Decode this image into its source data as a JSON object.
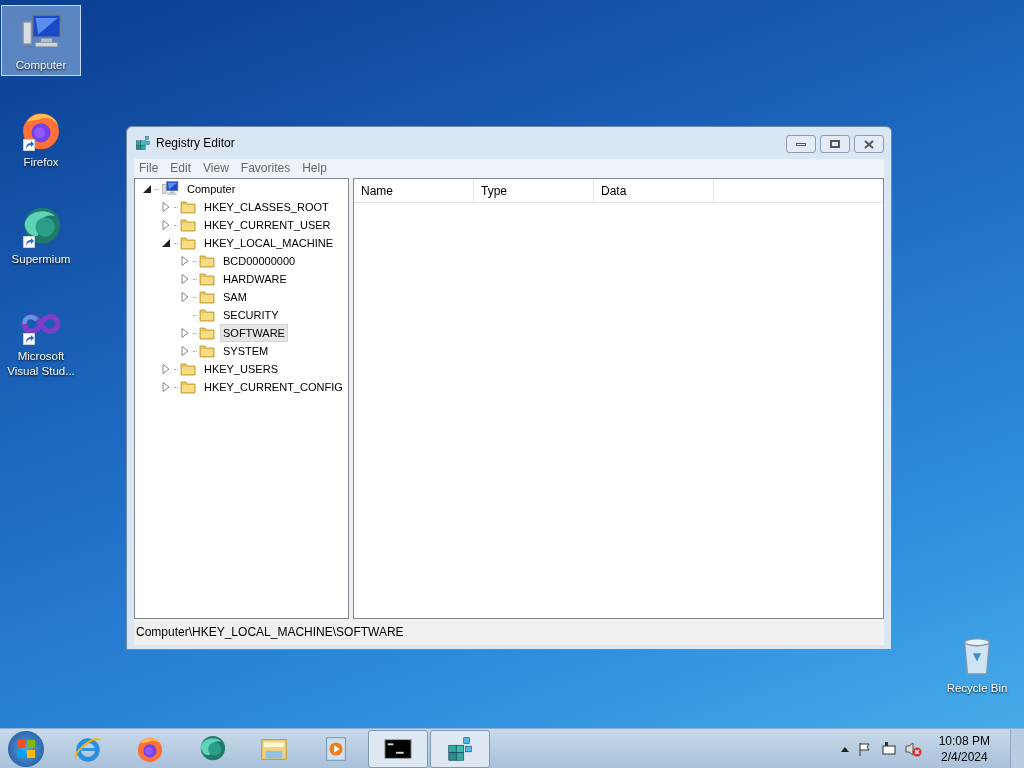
{
  "desktop_icons": [
    {
      "label": "Computer",
      "kind": "computer",
      "shortcut": false,
      "selected": true
    },
    {
      "label": "Firefox",
      "kind": "firefox",
      "shortcut": true,
      "selected": false
    },
    {
      "label": "Supermium",
      "kind": "supermium",
      "shortcut": true,
      "selected": false
    },
    {
      "label": "Microsoft Visual Stud...",
      "kind": "vs",
      "shortcut": true,
      "selected": false
    },
    {
      "label": "Recycle Bin",
      "kind": "recycle",
      "shortcut": false,
      "selected": false
    }
  ],
  "window": {
    "title": "Registry Editor",
    "menu": [
      "File",
      "Edit",
      "View",
      "Favorites",
      "Help"
    ],
    "tree": [
      {
        "label": "Computer",
        "kind": "computer",
        "expandable": true,
        "expanded": true,
        "selected": false,
        "children": [
          {
            "label": "HKEY_CLASSES_ROOT",
            "kind": "folder",
            "expandable": true,
            "expanded": false,
            "selected": false
          },
          {
            "label": "HKEY_CURRENT_USER",
            "kind": "folder",
            "expandable": true,
            "expanded": false,
            "selected": false
          },
          {
            "label": "HKEY_LOCAL_MACHINE",
            "kind": "folder",
            "expandable": true,
            "expanded": true,
            "selected": false,
            "children": [
              {
                "label": "BCD00000000",
                "kind": "folder",
                "expandable": true,
                "expanded": false,
                "selected": false
              },
              {
                "label": "HARDWARE",
                "kind": "folder",
                "expandable": true,
                "expanded": false,
                "selected": false
              },
              {
                "label": "SAM",
                "kind": "folder",
                "expandable": true,
                "expanded": false,
                "selected": false
              },
              {
                "label": "SECURITY",
                "kind": "folder",
                "expandable": false,
                "expanded": false,
                "selected": false
              },
              {
                "label": "SOFTWARE",
                "kind": "folder",
                "expandable": true,
                "expanded": false,
                "selected": true
              },
              {
                "label": "SYSTEM",
                "kind": "folder",
                "expandable": true,
                "expanded": false,
                "selected": false
              }
            ]
          },
          {
            "label": "HKEY_USERS",
            "kind": "folder",
            "expandable": true,
            "expanded": false,
            "selected": false
          },
          {
            "label": "HKEY_CURRENT_CONFIG",
            "kind": "folder",
            "expandable": true,
            "expanded": false,
            "selected": false
          }
        ]
      }
    ],
    "columns": [
      "Name",
      "Type",
      "Data"
    ],
    "status_bar": "Computer\\HKEY_LOCAL_MACHINE\\SOFTWARE"
  },
  "taskbar": {
    "buttons": [
      {
        "kind": "ie",
        "open": false
      },
      {
        "kind": "firefox",
        "open": false
      },
      {
        "kind": "supermium",
        "open": false
      },
      {
        "kind": "explorer",
        "open": false
      },
      {
        "kind": "media",
        "open": false
      },
      {
        "kind": "cmd",
        "open": true
      },
      {
        "kind": "regedit",
        "open": true
      }
    ],
    "clock": {
      "time": "10:08 PM",
      "date": "2/4/2024"
    }
  }
}
